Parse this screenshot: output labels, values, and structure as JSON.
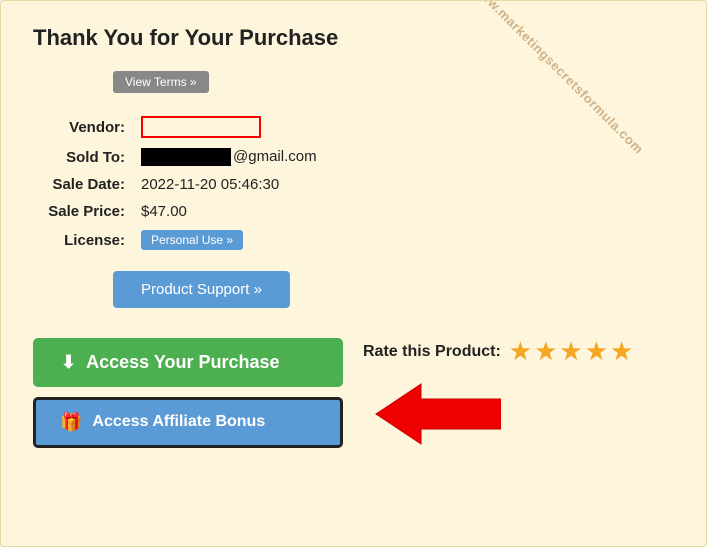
{
  "title": "Thank You for Your Purchase",
  "viewTerms": "View Terms »",
  "fields": {
    "vendor_label": "Vendor:",
    "soldTo_label": "Sold To:",
    "soldTo_email": "@gmail.com",
    "saleDate_label": "Sale Date:",
    "saleDate_value": "2022-11-20 05:46:30",
    "salePrice_label": "Sale Price:",
    "salePrice_value": "$47.00",
    "license_label": "License:",
    "license_value": "Personal Use »"
  },
  "productSupport": "Product Support »",
  "accessPurchase": "Access Your Purchase",
  "accessAffiliate": "Access Affiliate Bonus",
  "rateLabel": "Rate this Product:",
  "watermark": "www.marketingsecretsformula.com",
  "stars": [
    "★",
    "★",
    "★",
    "★",
    "★"
  ]
}
